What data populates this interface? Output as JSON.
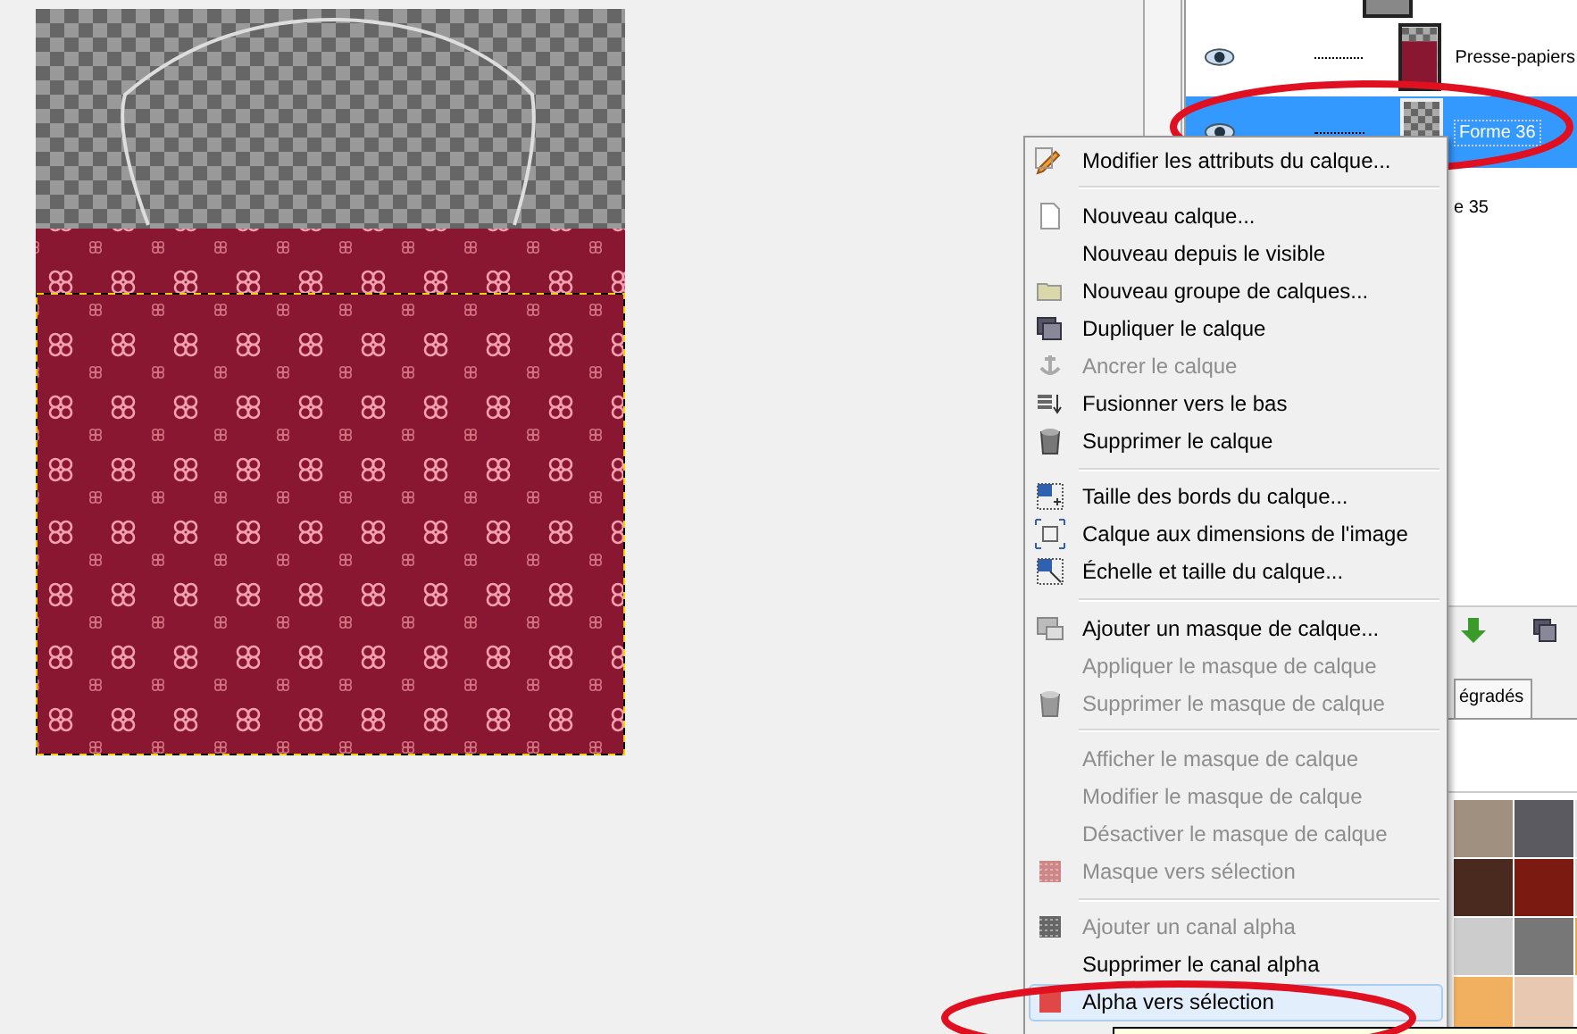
{
  "layers_panel": {
    "rows": [
      {
        "name": "Presse-papiers",
        "visible": true,
        "selected": false
      },
      {
        "name": "Forme 36",
        "visible": true,
        "selected": true
      },
      {
        "name": "e 35",
        "selected": false
      }
    ],
    "tab": {
      "label": "égradés"
    }
  },
  "context_menu": {
    "items": [
      {
        "kind": "item",
        "label": "Modifier les attributs du calque...",
        "disabled": false,
        "selected": false
      },
      {
        "kind": "separator"
      },
      {
        "kind": "item",
        "label": "Nouveau calque...",
        "disabled": false,
        "selected": false
      },
      {
        "kind": "item",
        "label": "Nouveau depuis le visible",
        "disabled": false,
        "selected": false
      },
      {
        "kind": "item",
        "label": "Nouveau groupe de calques...",
        "disabled": false,
        "selected": false
      },
      {
        "kind": "item",
        "label": "Dupliquer le calque",
        "disabled": false,
        "selected": false
      },
      {
        "kind": "item",
        "label": "Ancrer le calque",
        "disabled": true,
        "selected": false
      },
      {
        "kind": "item",
        "label": "Fusionner vers le bas",
        "disabled": false,
        "selected": false
      },
      {
        "kind": "item",
        "label": "Supprimer le calque",
        "disabled": false,
        "selected": false
      },
      {
        "kind": "separator"
      },
      {
        "kind": "item",
        "label": "Taille des bords du calque...",
        "disabled": false,
        "selected": false
      },
      {
        "kind": "item",
        "label": "Calque aux dimensions de l'image",
        "disabled": false,
        "selected": false
      },
      {
        "kind": "item",
        "label": "Échelle et taille du calque...",
        "disabled": false,
        "selected": false
      },
      {
        "kind": "separator"
      },
      {
        "kind": "item",
        "label": "Ajouter un masque de calque...",
        "disabled": false,
        "selected": false
      },
      {
        "kind": "item",
        "label": "Appliquer le masque de calque",
        "disabled": true,
        "selected": false
      },
      {
        "kind": "item",
        "label": "Supprimer le masque de calque",
        "disabled": true,
        "selected": false
      },
      {
        "kind": "separator"
      },
      {
        "kind": "item",
        "label": "Afficher le masque de calque",
        "disabled": true,
        "selected": false
      },
      {
        "kind": "item",
        "label": "Modifier le masque de calque",
        "disabled": true,
        "selected": false
      },
      {
        "kind": "item",
        "label": "Désactiver le masque de calque",
        "disabled": true,
        "selected": false
      },
      {
        "kind": "item",
        "label": "Masque vers sélection",
        "disabled": true,
        "selected": false
      },
      {
        "kind": "separator"
      },
      {
        "kind": "item",
        "label": "Ajouter un canal alpha",
        "disabled": true,
        "selected": false
      },
      {
        "kind": "item",
        "label": "Supprimer le canal alpha",
        "disabled": false,
        "selected": false
      },
      {
        "kind": "item",
        "label": "Alpha vers sélection",
        "disabled": false,
        "selected": true
      }
    ]
  }
}
